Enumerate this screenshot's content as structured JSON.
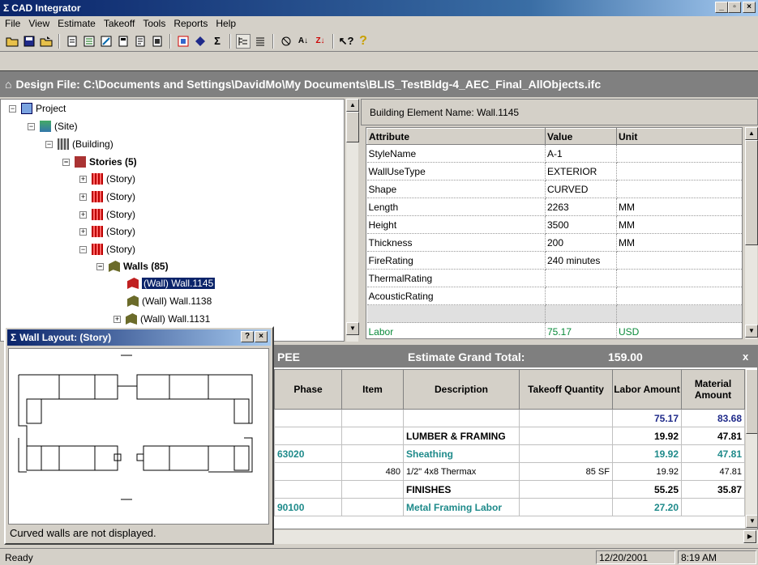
{
  "window": {
    "title": "CAD Integrator",
    "sigma": "Σ",
    "min": "_",
    "max": "▫",
    "close": "×"
  },
  "menu": [
    "File",
    "View",
    "Estimate",
    "Takeoff",
    "Tools",
    "Reports",
    "Help"
  ],
  "toolbar_icons": [
    "open-folder-icon",
    "save-icon",
    "open-icon",
    "new-takeoff-icon",
    "takeoff-icon",
    "import-icon",
    "document-icon",
    "report-icon",
    "print-icon",
    "estimate-icon",
    "diamond-icon",
    "sum-icon",
    "tree-icon",
    "list-icon",
    "settings-icon",
    "sort-ascending-icon",
    "sort-descending-icon",
    "help-cursor-icon",
    "help-icon"
  ],
  "banner": {
    "label": "Design File: C:\\Documents and Settings\\DavidMo\\My Documents\\BLIS_TestBldg-4_AEC_Final_AllObjects.ifc"
  },
  "tree": {
    "items": [
      {
        "label": "Project",
        "toggle": "⊟"
      },
      {
        "label": "(Site)",
        "toggle": "⊟"
      },
      {
        "label": "(Building)",
        "toggle": "⊟"
      },
      {
        "label": "Stories  (5)",
        "toggle": "⊟"
      },
      {
        "label": "(Story)",
        "toggle": "⊞"
      },
      {
        "label": "(Story)",
        "toggle": "⊞"
      },
      {
        "label": "(Story)",
        "toggle": "⊞"
      },
      {
        "label": "(Story)",
        "toggle": "⊞"
      },
      {
        "label": "(Story)",
        "toggle": "⊟"
      },
      {
        "label": "Walls  (85)",
        "toggle": "⊟"
      },
      {
        "label": "(Wall)  Wall.1145",
        "toggle": ""
      },
      {
        "label": "(Wall)  Wall.1138",
        "toggle": ""
      },
      {
        "label": "(Wall)  Wall.1131",
        "toggle": "⊞"
      }
    ]
  },
  "attributes": {
    "element_name": "Building Element Name: Wall.1145",
    "headers": [
      "Attribute",
      "Value",
      "Unit"
    ],
    "rows": [
      [
        "StyleName",
        "A-1",
        ""
      ],
      [
        "WallUseType",
        "EXTERIOR",
        ""
      ],
      [
        "Shape",
        "CURVED",
        ""
      ],
      [
        "Length",
        "2263",
        "MM"
      ],
      [
        "Height",
        "3500",
        "MM"
      ],
      [
        "Thickness",
        "200",
        "MM"
      ],
      [
        "FireRating",
        "240 minutes",
        ""
      ],
      [
        "ThermalRating",
        "",
        ""
      ],
      [
        "AcousticRating",
        "",
        ""
      ]
    ],
    "labor_row": [
      "Labor",
      "75.17",
      "USD"
    ]
  },
  "estimate": {
    "header_left": "PEE",
    "grand_total_label": "Estimate Grand Total:",
    "grand_total_value": "159.00",
    "close": "x",
    "columns": [
      "Phase",
      "Item",
      "Description",
      "Takeoff Quantity",
      "Labor Amount",
      "Material Amount"
    ],
    "rows": [
      {
        "phase": "",
        "item": "",
        "desc": "",
        "qty": "",
        "labor": "75.17",
        "material": "83.68",
        "style": "blue"
      },
      {
        "phase": "",
        "item": "",
        "desc": "LUMBER & FRAMING",
        "qty": "",
        "labor": "19.92",
        "material": "47.81",
        "style": "bold"
      },
      {
        "phase": "63020",
        "item": "",
        "desc": "Sheathing",
        "qty": "",
        "labor": "19.92",
        "material": "47.81",
        "style": "teal"
      },
      {
        "phase": "",
        "item": "480",
        "desc": "1/2\" 4x8  Thermax",
        "qty": "85  SF",
        "labor": "19.92",
        "material": "47.81",
        "style": "plain"
      },
      {
        "phase": "",
        "item": "",
        "desc": "FINISHES",
        "qty": "",
        "labor": "55.25",
        "material": "35.87",
        "style": "bold"
      },
      {
        "phase": "90100",
        "item": "",
        "desc": "Metal Framing Labor",
        "qty": "",
        "labor": "27.20",
        "material": "",
        "style": "teal"
      }
    ]
  },
  "wall_layout": {
    "title": "Wall Layout: (Story)",
    "help": "?",
    "close": "×",
    "note": "Curved walls are not displayed."
  },
  "status": {
    "text": "Ready",
    "date": "12/20/2001",
    "time": "8:19 AM"
  }
}
